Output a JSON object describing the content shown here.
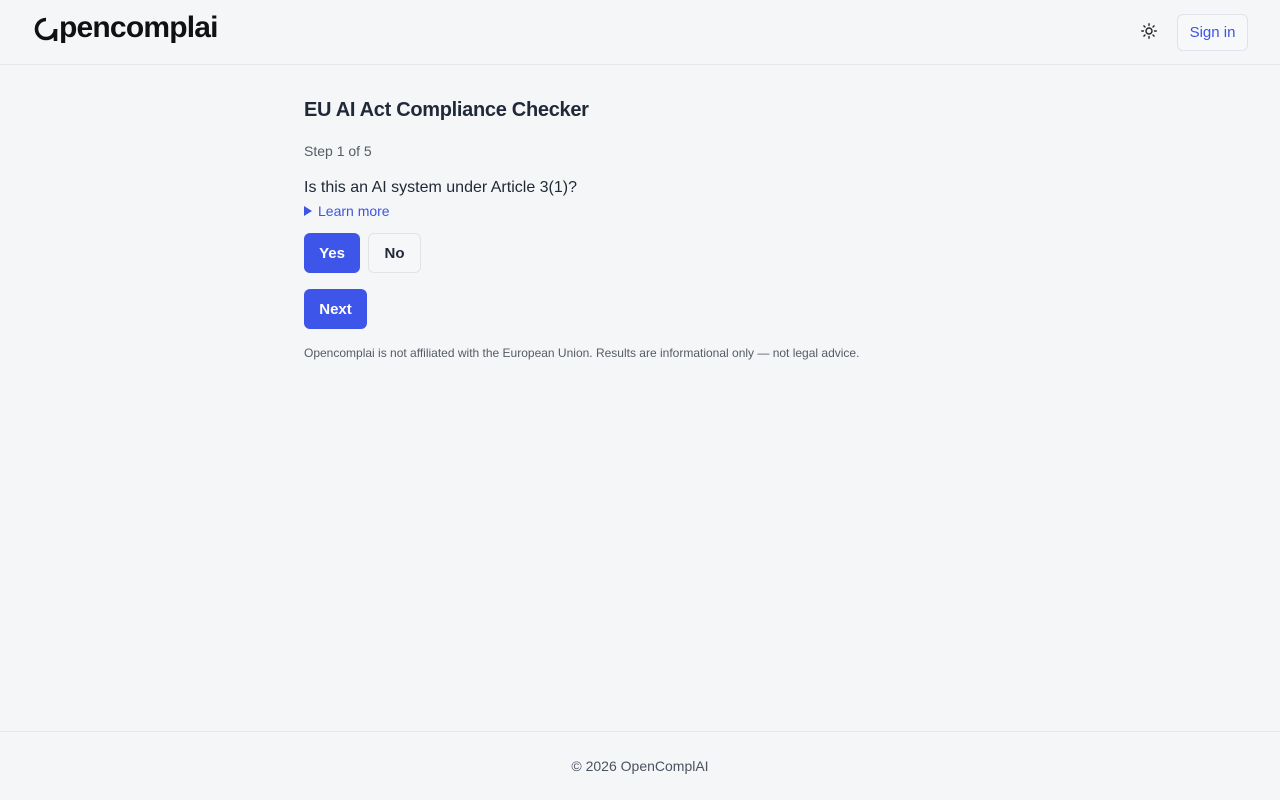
{
  "header": {
    "logo_text": "pencomplai",
    "logo_mark": "O",
    "theme_toggle_icon": "sun-icon",
    "signin_label": "Sign in"
  },
  "main": {
    "title": "EU AI Act Compliance Checker",
    "step": "Step 1 of 5",
    "question": "Is this an AI system under Article 3(1)?",
    "learn_more": "Learn more",
    "yes_label": "Yes",
    "no_label": "No",
    "next_label": "Next",
    "disclaimer": "Opencomplai is not affiliated with the European Union. Results are informational only — not legal advice."
  },
  "footer": {
    "copyright": "© 2026 OpenComplAI"
  },
  "colors": {
    "accent": "#3d55e8",
    "background": "#f5f6f8",
    "text": "#1f2937"
  }
}
